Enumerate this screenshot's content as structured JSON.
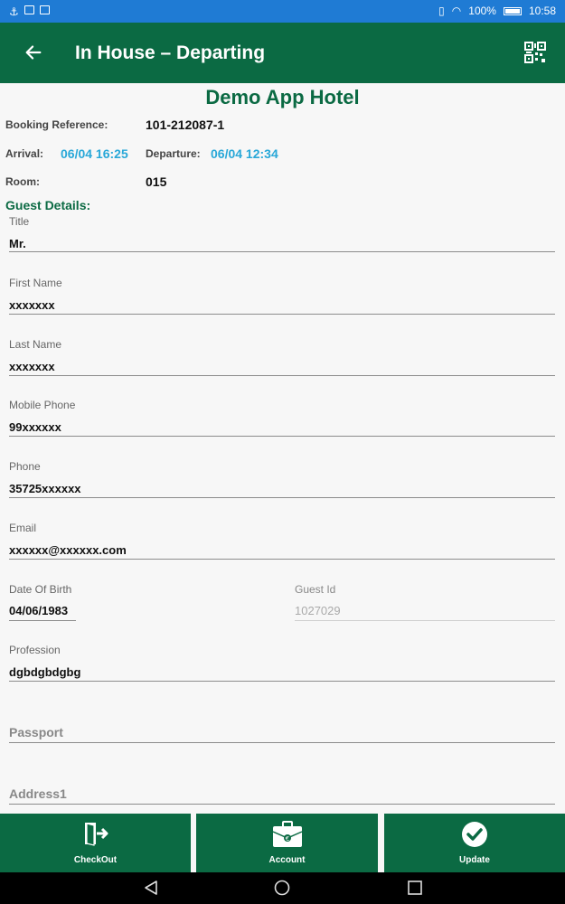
{
  "status_bar": {
    "battery": "100%",
    "time": "10:58"
  },
  "app_bar": {
    "title": "In House – Departing"
  },
  "hotel": {
    "name": "Demo App Hotel"
  },
  "booking": {
    "reference_label": "Booking Reference:",
    "reference_value": "101-212087-1",
    "arrival_label": "Arrival:",
    "arrival_value": "06/04 16:25",
    "departure_label": "Departure:",
    "departure_value": "06/04 12:34",
    "room_label": "Room:",
    "room_value": "015"
  },
  "guest": {
    "section_title": "Guest Details:",
    "title_label": "Title",
    "title_value": "Mr.",
    "first_name_label": "First Name",
    "first_name_value": "xxxxxxx",
    "last_name_label": "Last Name",
    "last_name_value": "xxxxxxx",
    "mobile_label": "Mobile Phone",
    "mobile_value": "99xxxxxx",
    "phone_label": "Phone",
    "phone_value": "35725xxxxxx",
    "email_label": "Email",
    "email_value": "xxxxxx@xxxxxx.com",
    "dob_label": "Date Of Birth",
    "dob_value": "04/06/1983",
    "guest_id_label": "Guest Id",
    "guest_id_value": "1027029",
    "profession_label": "Profession",
    "profession_value": "dgbdgbdgbg",
    "passport_placeholder": "Passport",
    "address1_placeholder": "Address1"
  },
  "actions": {
    "checkout_label": "CheckOut",
    "account_label": "Account",
    "update_label": "Update"
  },
  "colors": {
    "primary": "#0b6a43",
    "status_bar": "#1f7bd4",
    "accent_blue": "#29a8d8"
  }
}
